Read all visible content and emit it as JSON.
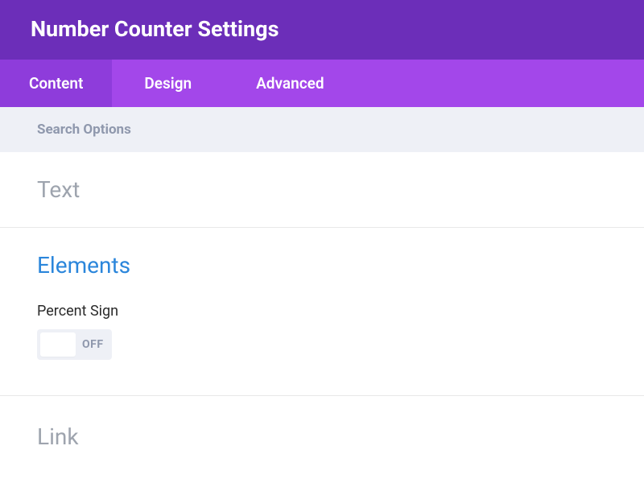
{
  "header": {
    "title": "Number Counter Settings"
  },
  "tabs": {
    "content": "Content",
    "design": "Design",
    "advanced": "Advanced"
  },
  "search": {
    "placeholder": "Search Options"
  },
  "sections": {
    "text": {
      "heading": "Text"
    },
    "elements": {
      "heading": "Elements",
      "percent_sign_label": "Percent Sign",
      "percent_sign_state": "OFF"
    },
    "link": {
      "heading": "Link"
    }
  }
}
